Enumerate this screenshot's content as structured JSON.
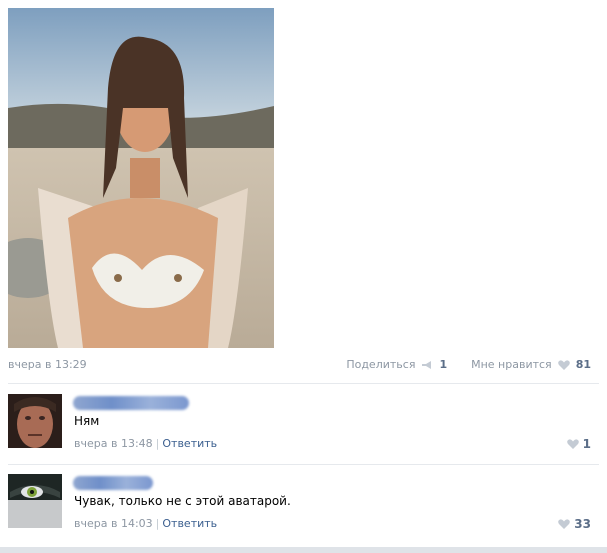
{
  "post": {
    "time": "вчера в 13:29",
    "share_label": "Поделиться",
    "share_count": "1",
    "like_label": "Мне нравится",
    "like_count": "81"
  },
  "comments": [
    {
      "text": "Ням",
      "time": "вчера в 13:48",
      "reply_label": "Ответить",
      "likes": "1"
    },
    {
      "text": "Чувак, только не с этой аватарой.",
      "time": "вчера в 14:03",
      "reply_label": "Ответить",
      "likes": "33"
    }
  ],
  "colors": {
    "link": "#3b5f8f",
    "meta": "#8d97a3",
    "count": "#5b6e88"
  }
}
